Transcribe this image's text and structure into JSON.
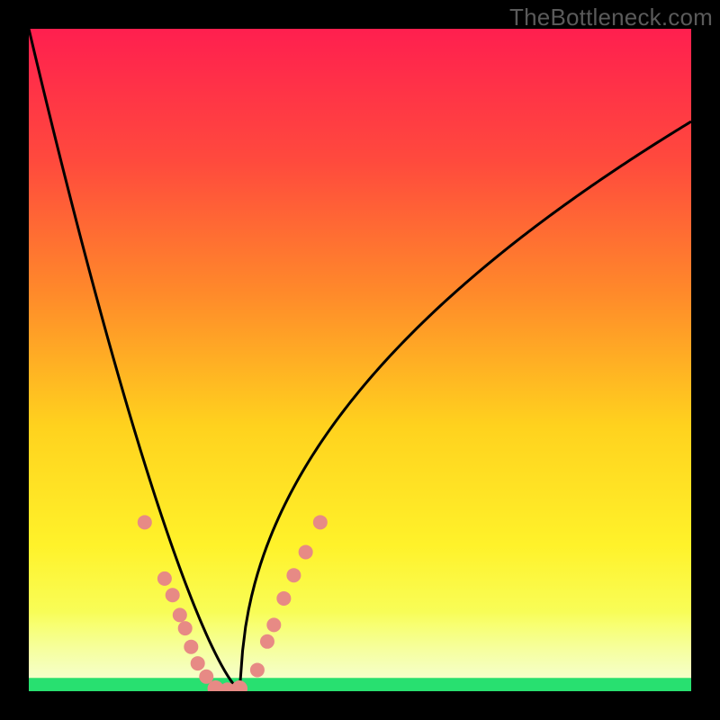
{
  "watermark": "TheBottleneck.com",
  "chart_data": {
    "type": "line",
    "title": "",
    "xlabel": "",
    "ylabel": "",
    "xlim": [
      0,
      1
    ],
    "ylim": [
      0,
      1
    ],
    "series": [
      {
        "name": "curve",
        "x": [
          0.0,
          0.04,
          0.08,
          0.12,
          0.16,
          0.2,
          0.24,
          0.28,
          0.32,
          1.0
        ],
        "y": [
          1.0,
          0.82,
          0.64,
          0.47,
          0.3,
          0.15,
          0.05,
          0.01,
          0.0,
          0.86
        ]
      }
    ],
    "markers": {
      "left": [
        {
          "x": 0.175,
          "y": 0.255
        },
        {
          "x": 0.205,
          "y": 0.17
        },
        {
          "x": 0.217,
          "y": 0.145
        },
        {
          "x": 0.228,
          "y": 0.115
        },
        {
          "x": 0.236,
          "y": 0.095
        },
        {
          "x": 0.245,
          "y": 0.067
        },
        {
          "x": 0.255,
          "y": 0.042
        },
        {
          "x": 0.268,
          "y": 0.022
        }
      ],
      "right": [
        {
          "x": 0.345,
          "y": 0.032
        },
        {
          "x": 0.36,
          "y": 0.075
        },
        {
          "x": 0.37,
          "y": 0.1
        },
        {
          "x": 0.385,
          "y": 0.14
        },
        {
          "x": 0.4,
          "y": 0.175
        },
        {
          "x": 0.418,
          "y": 0.21
        },
        {
          "x": 0.44,
          "y": 0.255
        }
      ],
      "bottom": [
        {
          "x": 0.282,
          "y": 0.004
        },
        {
          "x": 0.3,
          "y": 0.001
        },
        {
          "x": 0.318,
          "y": 0.004
        }
      ]
    },
    "bottom_band": {
      "y": 0.02,
      "color": "#28e070"
    },
    "glow_band": {
      "y0": 0.02,
      "y1": 0.12
    },
    "gradient_stops": [
      {
        "t": 0.0,
        "c": "#ff1f4f"
      },
      {
        "t": 0.2,
        "c": "#ff4a3d"
      },
      {
        "t": 0.4,
        "c": "#ff8a2a"
      },
      {
        "t": 0.6,
        "c": "#ffd21e"
      },
      {
        "t": 0.78,
        "c": "#fff22a"
      },
      {
        "t": 0.9,
        "c": "#f7ff60"
      },
      {
        "t": 1.0,
        "c": "#e8ff90"
      }
    ],
    "marker_color": "#e78a85",
    "curve_color": "#000000"
  }
}
